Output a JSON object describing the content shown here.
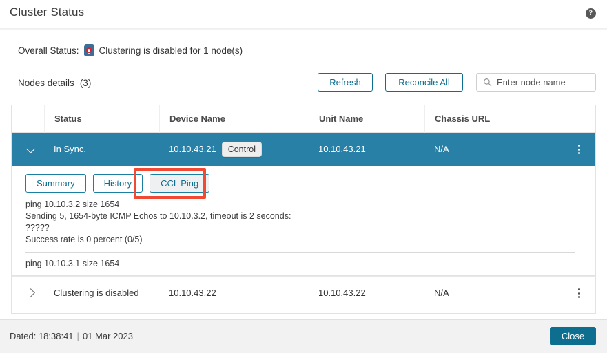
{
  "window": {
    "title": "Cluster Status",
    "help_icon": "help-circle-icon"
  },
  "overall": {
    "label": "Overall Status:",
    "icon": "device-error-icon",
    "message": "Clustering is disabled for 1 node(s)"
  },
  "toolbar": {
    "nodes_details_label": "Nodes details",
    "nodes_count": "(3)",
    "refresh_label": "Refresh",
    "reconcile_label": "Reconcile All",
    "search_placeholder": "Enter node name",
    "search_value": "",
    "search_icon": "search-icon"
  },
  "table": {
    "columns": [
      "",
      "Status",
      "Device Name",
      "Unit Name",
      "Chassis URL",
      ""
    ],
    "rows": [
      {
        "expanded": true,
        "chevron": "chevron-down-icon",
        "status": "In Sync.",
        "device_name": "10.10.43.21",
        "device_badge": "Control",
        "unit_name": "10.10.43.21",
        "chassis_url": "N/A",
        "menu": "kebab-menu-icon"
      },
      {
        "expanded": false,
        "chevron": "chevron-right-icon",
        "status": "Clustering is disabled",
        "device_name": "10.10.43.22",
        "device_badge": "",
        "unit_name": "10.10.43.22",
        "chassis_url": "N/A",
        "menu": "kebab-menu-icon"
      }
    ]
  },
  "detail": {
    "tabs": [
      {
        "label": "Summary",
        "active": false
      },
      {
        "label": "History",
        "active": false
      },
      {
        "label": "CCL Ping",
        "active": true
      }
    ],
    "highlighted_tab": "CCL Ping",
    "highlight_color": "#f04a34",
    "console_block1": [
      "ping 10.10.3.2 size 1654",
      "Sending 5, 1654-byte ICMP Echos to 10.10.3.2, timeout is 2 seconds:",
      "?????",
      "Success rate is 0 percent (0/5)"
    ],
    "console_block2": [
      "ping 10.10.3.1 size 1654"
    ]
  },
  "footer": {
    "date_label": "Dated:",
    "time": "18:38:41",
    "separator": "|",
    "date": "01 Mar 2023",
    "close_label": "Close"
  },
  "colors": {
    "accent": "#0d6e8f",
    "selected_row": "#2980a6",
    "highlight": "#f04a34",
    "footer_bg": "#f2f2f2"
  }
}
